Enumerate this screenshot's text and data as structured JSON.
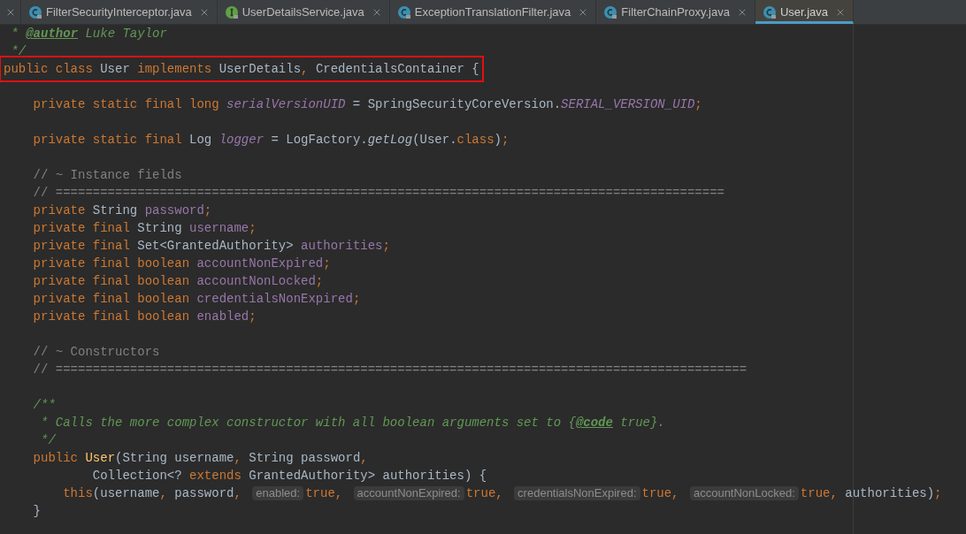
{
  "tabs": [
    {
      "label": "FilterSecurityInterceptor.java",
      "kind": "class",
      "selected": false
    },
    {
      "label": "UserDetailsService.java",
      "kind": "interface",
      "selected": false
    },
    {
      "label": "ExceptionTranslationFilter.java",
      "kind": "class",
      "selected": false
    },
    {
      "label": "FilterChainProxy.java",
      "kind": "class",
      "selected": false
    },
    {
      "label": "User.java",
      "kind": "class",
      "selected": true
    }
  ],
  "editor": {
    "lines": [
      {
        "highlighted": false,
        "tokens": [
          {
            "kind": "doc",
            "text": " * "
          },
          {
            "kind": "doctag",
            "text": "@author"
          },
          {
            "kind": "doc",
            "text": " Luke Taylor"
          }
        ]
      },
      {
        "highlighted": false,
        "tokens": [
          {
            "kind": "doc",
            "text": " */"
          }
        ]
      },
      {
        "highlighted": true,
        "tokens": [
          {
            "kind": "kw",
            "text": "public class "
          },
          {
            "kind": "plain",
            "text": "User "
          },
          {
            "kind": "kw",
            "text": "implements "
          },
          {
            "kind": "plain",
            "text": "UserDetails"
          },
          {
            "kind": "kw",
            "text": ", "
          },
          {
            "kind": "plain",
            "text": "CredentialsContainer {"
          }
        ]
      },
      {
        "highlighted": false
      },
      {
        "highlighted": false,
        "tokens": [
          {
            "kind": "kw",
            "text": "    private static final long "
          },
          {
            "kind": "sfield",
            "text": "serialVersionUID"
          },
          {
            "kind": "plain",
            "text": " = SpringSecurityCoreVersion."
          },
          {
            "kind": "sfield",
            "text": "SERIAL_VERSION_UID"
          },
          {
            "kind": "kw",
            "text": ";"
          }
        ]
      },
      {
        "highlighted": false
      },
      {
        "highlighted": false,
        "tokens": [
          {
            "kind": "kw",
            "text": "    private static final "
          },
          {
            "kind": "plain",
            "text": "Log "
          },
          {
            "kind": "sfield",
            "text": "logger"
          },
          {
            "kind": "plain",
            "text": " = LogFactory."
          },
          {
            "kind": "italic",
            "text": "getLog"
          },
          {
            "kind": "plain",
            "text": "(User."
          },
          {
            "kind": "kw",
            "text": "class"
          },
          {
            "kind": "plain",
            "text": ")"
          },
          {
            "kind": "kw",
            "text": ";"
          }
        ]
      },
      {
        "highlighted": false
      },
      {
        "highlighted": false,
        "tokens": [
          {
            "kind": "comment",
            "text": "    // ~ Instance fields"
          }
        ]
      },
      {
        "highlighted": false,
        "tokens": [
          {
            "kind": "comment",
            "text": "    // =========================================================================================="
          }
        ]
      },
      {
        "highlighted": false,
        "tokens": [
          {
            "kind": "kw",
            "text": "    private "
          },
          {
            "kind": "plain",
            "text": "String "
          },
          {
            "kind": "field",
            "text": "password"
          },
          {
            "kind": "kw",
            "text": ";"
          }
        ]
      },
      {
        "highlighted": false,
        "tokens": [
          {
            "kind": "kw",
            "text": "    private final "
          },
          {
            "kind": "plain",
            "text": "String "
          },
          {
            "kind": "field",
            "text": "username"
          },
          {
            "kind": "kw",
            "text": ";"
          }
        ]
      },
      {
        "highlighted": false,
        "tokens": [
          {
            "kind": "kw",
            "text": "    private final "
          },
          {
            "kind": "plain",
            "text": "Set<GrantedAuthority> "
          },
          {
            "kind": "field",
            "text": "authorities"
          },
          {
            "kind": "kw",
            "text": ";"
          }
        ]
      },
      {
        "highlighted": false,
        "tokens": [
          {
            "kind": "kw",
            "text": "    private final boolean "
          },
          {
            "kind": "field",
            "text": "accountNonExpired"
          },
          {
            "kind": "kw",
            "text": ";"
          }
        ]
      },
      {
        "highlighted": false,
        "tokens": [
          {
            "kind": "kw",
            "text": "    private final boolean "
          },
          {
            "kind": "field",
            "text": "accountNonLocked"
          },
          {
            "kind": "kw",
            "text": ";"
          }
        ]
      },
      {
        "highlighted": false,
        "tokens": [
          {
            "kind": "kw",
            "text": "    private final boolean "
          },
          {
            "kind": "field",
            "text": "credentialsNonExpired"
          },
          {
            "kind": "kw",
            "text": ";"
          }
        ]
      },
      {
        "highlighted": false,
        "tokens": [
          {
            "kind": "kw",
            "text": "    private final boolean "
          },
          {
            "kind": "field",
            "text": "enabled"
          },
          {
            "kind": "kw",
            "text": ";"
          }
        ]
      },
      {
        "highlighted": false
      },
      {
        "highlighted": false,
        "tokens": [
          {
            "kind": "comment",
            "text": "    // ~ Constructors"
          }
        ]
      },
      {
        "highlighted": false,
        "tokens": [
          {
            "kind": "comment",
            "text": "    // ============================================================================================="
          }
        ]
      },
      {
        "highlighted": false
      },
      {
        "highlighted": false,
        "tokens": [
          {
            "kind": "doc",
            "text": "    /**"
          }
        ]
      },
      {
        "highlighted": false,
        "tokens": [
          {
            "kind": "doc",
            "text": "     * Calls the more complex constructor with all boolean arguments set to {"
          },
          {
            "kind": "doctag",
            "text": "@code"
          },
          {
            "kind": "doc",
            "text": " true}."
          }
        ]
      },
      {
        "highlighted": false,
        "tokens": [
          {
            "kind": "doc",
            "text": "     */"
          }
        ]
      },
      {
        "highlighted": false,
        "tokens": [
          {
            "kind": "kw",
            "text": "    public "
          },
          {
            "kind": "method",
            "text": "User"
          },
          {
            "kind": "plain",
            "text": "(String username"
          },
          {
            "kind": "kw",
            "text": ", "
          },
          {
            "kind": "plain",
            "text": "String password"
          },
          {
            "kind": "kw",
            "text": ","
          }
        ]
      },
      {
        "highlighted": false,
        "tokens": [
          {
            "kind": "plain",
            "text": "            Collection<? "
          },
          {
            "kind": "kw",
            "text": "extends "
          },
          {
            "kind": "plain",
            "text": "GrantedAuthority> authorities) {"
          }
        ]
      },
      {
        "highlighted": false,
        "tokens": [
          {
            "kind": "kw",
            "text": "        this"
          },
          {
            "kind": "plain",
            "text": "(username"
          },
          {
            "kind": "kw",
            "text": ", "
          },
          {
            "kind": "plain",
            "text": "password"
          },
          {
            "kind": "kw",
            "text": ", "
          },
          {
            "kind": "hint",
            "text": "enabled:"
          },
          {
            "kind": "kw",
            "text": "true, "
          },
          {
            "kind": "hint",
            "text": "accountNonExpired:"
          },
          {
            "kind": "kw",
            "text": "true, "
          },
          {
            "kind": "hint",
            "text": "credentialsNonExpired:"
          },
          {
            "kind": "kw",
            "text": "true, "
          },
          {
            "kind": "hint",
            "text": "accountNonLocked:"
          },
          {
            "kind": "kw",
            "text": "true, "
          },
          {
            "kind": "plain",
            "text": "authorities)"
          },
          {
            "kind": "kw",
            "text": ";"
          }
        ]
      },
      {
        "highlighted": false,
        "tokens": [
          {
            "kind": "plain",
            "text": "    }"
          }
        ]
      }
    ]
  }
}
